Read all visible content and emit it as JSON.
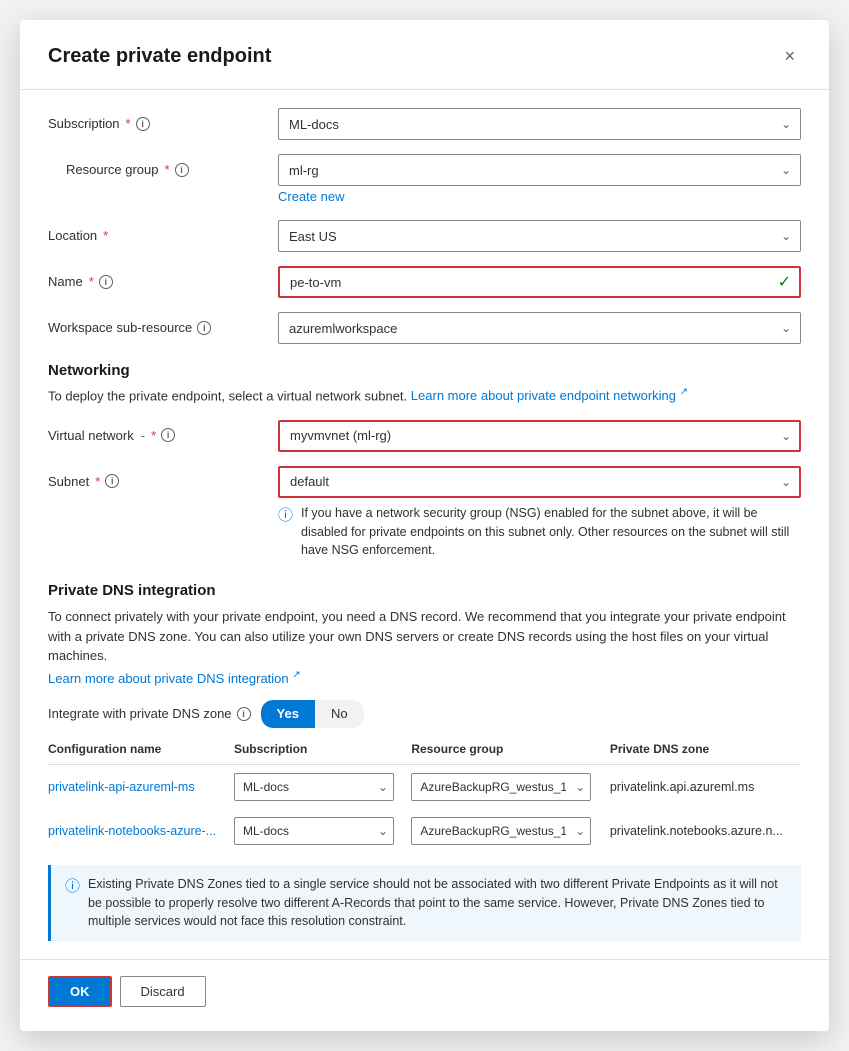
{
  "dialog": {
    "title": "Create private endpoint",
    "close_label": "×"
  },
  "form": {
    "subscription_label": "Subscription",
    "subscription_value": "ML-docs",
    "resource_group_label": "Resource group",
    "resource_group_value": "ml-rg",
    "create_new_label": "Create new",
    "location_label": "Location",
    "location_value": "East US",
    "name_label": "Name",
    "name_value": "pe-to-vm",
    "workspace_label": "Workspace sub-resource",
    "workspace_value": "azuremlworkspace",
    "networking_title": "Networking",
    "networking_info": "To deploy the private endpoint, select a virtual network subnet.",
    "networking_link": "Learn more about private endpoint networking",
    "virtual_network_label": "Virtual network",
    "virtual_network_dash": "-",
    "virtual_network_value": "myvmvnet (ml-rg)",
    "subnet_label": "Subnet",
    "subnet_value": "default",
    "nsg_info": "If you have a network security group (NSG) enabled for the subnet above, it will be disabled for private endpoints on this subnet only. Other resources on the subnet will still have NSG enforcement.",
    "private_dns_title": "Private DNS integration",
    "private_dns_info1": "To connect privately with your private endpoint, you need a DNS record. We recommend that you integrate your private endpoint with a private DNS zone. You can also utilize your own DNS servers or create DNS records using the host files on your virtual machines.",
    "private_dns_link": "Learn more about private DNS integration",
    "integrate_label": "Integrate with private DNS zone",
    "toggle_yes": "Yes",
    "toggle_no": "No",
    "table": {
      "headers": [
        "Configuration name",
        "Subscription",
        "Resource group",
        "Private DNS zone"
      ],
      "rows": [
        {
          "config_name": "privatelink-api-azureml-ms",
          "subscription": "ML-docs",
          "resource_group": "AzureBackupRG_westus_1",
          "dns_zone": "privatelink.api.azureml.ms"
        },
        {
          "config_name": "privatelink-notebooks-azure-...",
          "subscription": "ML-docs",
          "resource_group": "AzureBackupRG_westus_1",
          "dns_zone": "privatelink.notebooks.azure.n..."
        }
      ]
    },
    "warning_text": "Existing Private DNS Zones tied to a single service should not be associated with two different Private Endpoints as it will not be possible to properly resolve two different A-Records that point to the same service. However, Private DNS Zones tied to multiple services would not face this resolution constraint.",
    "ok_label": "OK",
    "discard_label": "Discard"
  }
}
